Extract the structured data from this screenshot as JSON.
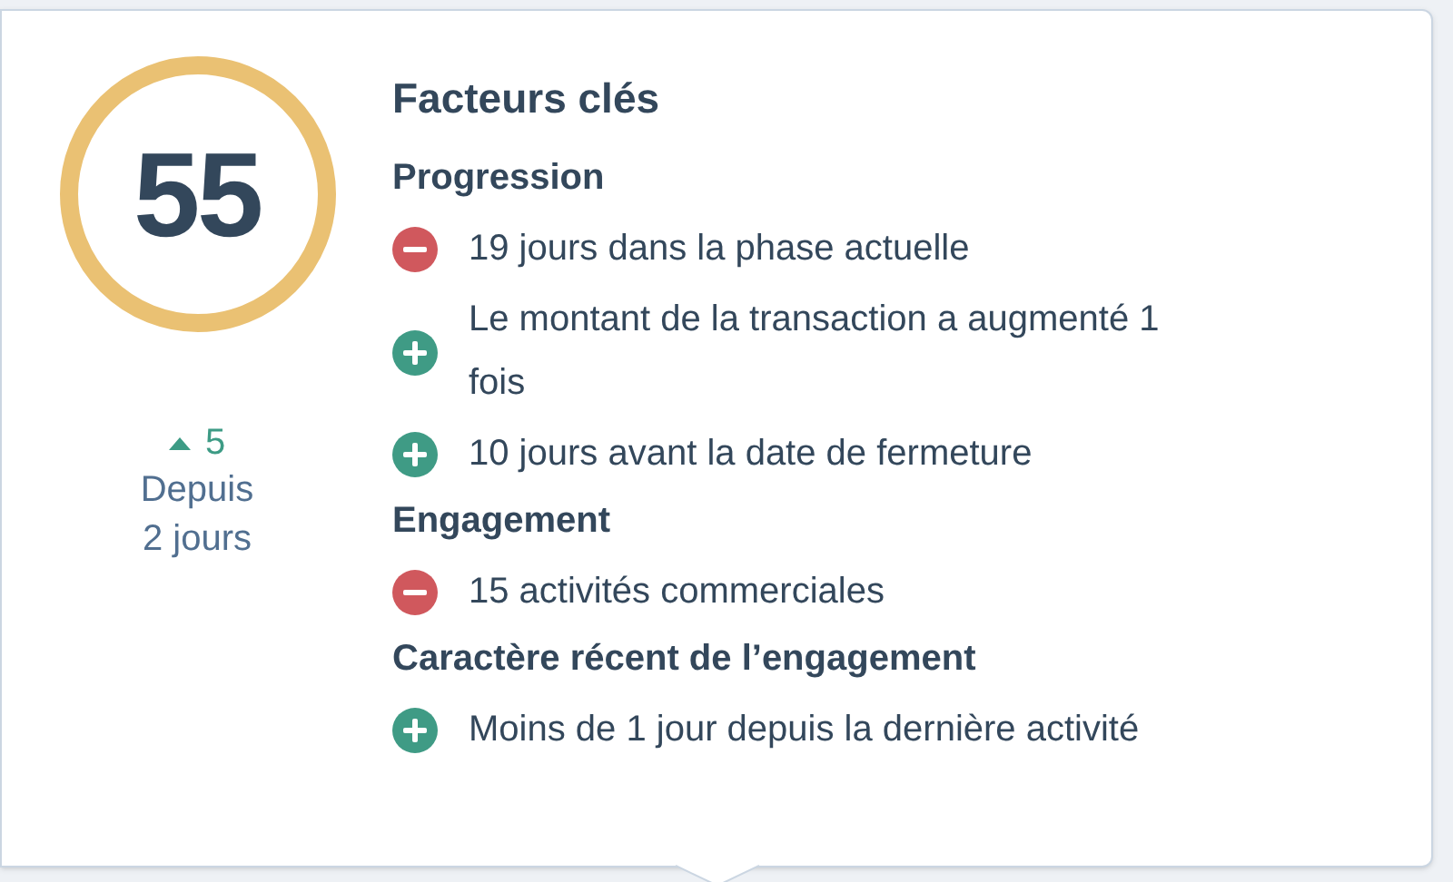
{
  "score": {
    "value": "55",
    "trend": {
      "up": true,
      "value": "5"
    },
    "period": "Depuis 2 jours"
  },
  "title": "Facteurs clés",
  "sections": [
    {
      "heading": "Progression",
      "items": [
        {
          "kind": "negative",
          "text": "19 jours dans la phase actuelle"
        },
        {
          "kind": "positive",
          "text": "Le montant de la transaction a augmenté 1 fois"
        },
        {
          "kind": "positive",
          "text": "10 jours avant la date de fermeture"
        }
      ]
    },
    {
      "heading": "Engagement",
      "items": [
        {
          "kind": "negative",
          "text": "15 activités commerciales"
        }
      ]
    },
    {
      "heading": "Caractère récent de l’engagement",
      "items": [
        {
          "kind": "positive",
          "text": "Moins de 1 jour depuis la dernière activité"
        }
      ]
    }
  ]
}
